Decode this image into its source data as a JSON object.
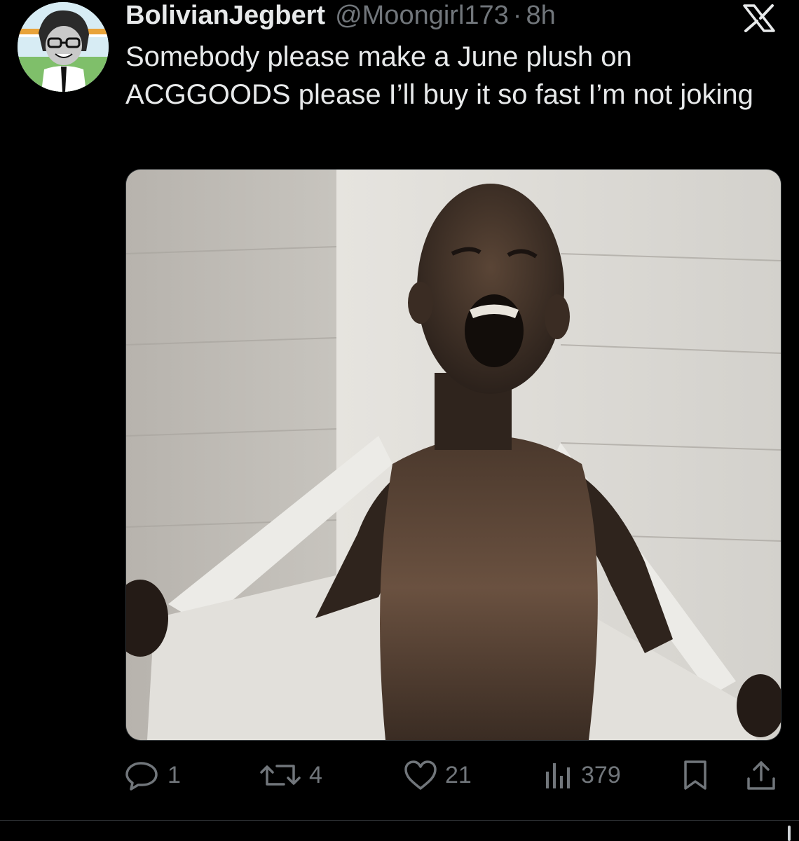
{
  "tweet": {
    "display_name": "BolivianJegbert",
    "handle": "@Moongirl173",
    "separator": "·",
    "time": "8h",
    "text": "Somebody please make a June plush on ACGGOODS please I’ll buy it so fast I’m not joking"
  },
  "icons": {
    "avatar": "cartoon-avatar",
    "platform": "x-logo",
    "media": "meme-photo"
  },
  "actions": {
    "reply": {
      "icon": "reply-icon",
      "count": "1"
    },
    "retweet": {
      "icon": "retweet-icon",
      "count": "4"
    },
    "like": {
      "icon": "heart-icon",
      "count": "21"
    },
    "views": {
      "icon": "views-icon",
      "count": "379"
    },
    "bookmark": {
      "icon": "bookmark-icon"
    },
    "share": {
      "icon": "share-icon"
    }
  },
  "colors": {
    "background": "#000000",
    "primary_text": "#e7e9ea",
    "secondary_text": "#71767b",
    "border": "#2f3336"
  }
}
